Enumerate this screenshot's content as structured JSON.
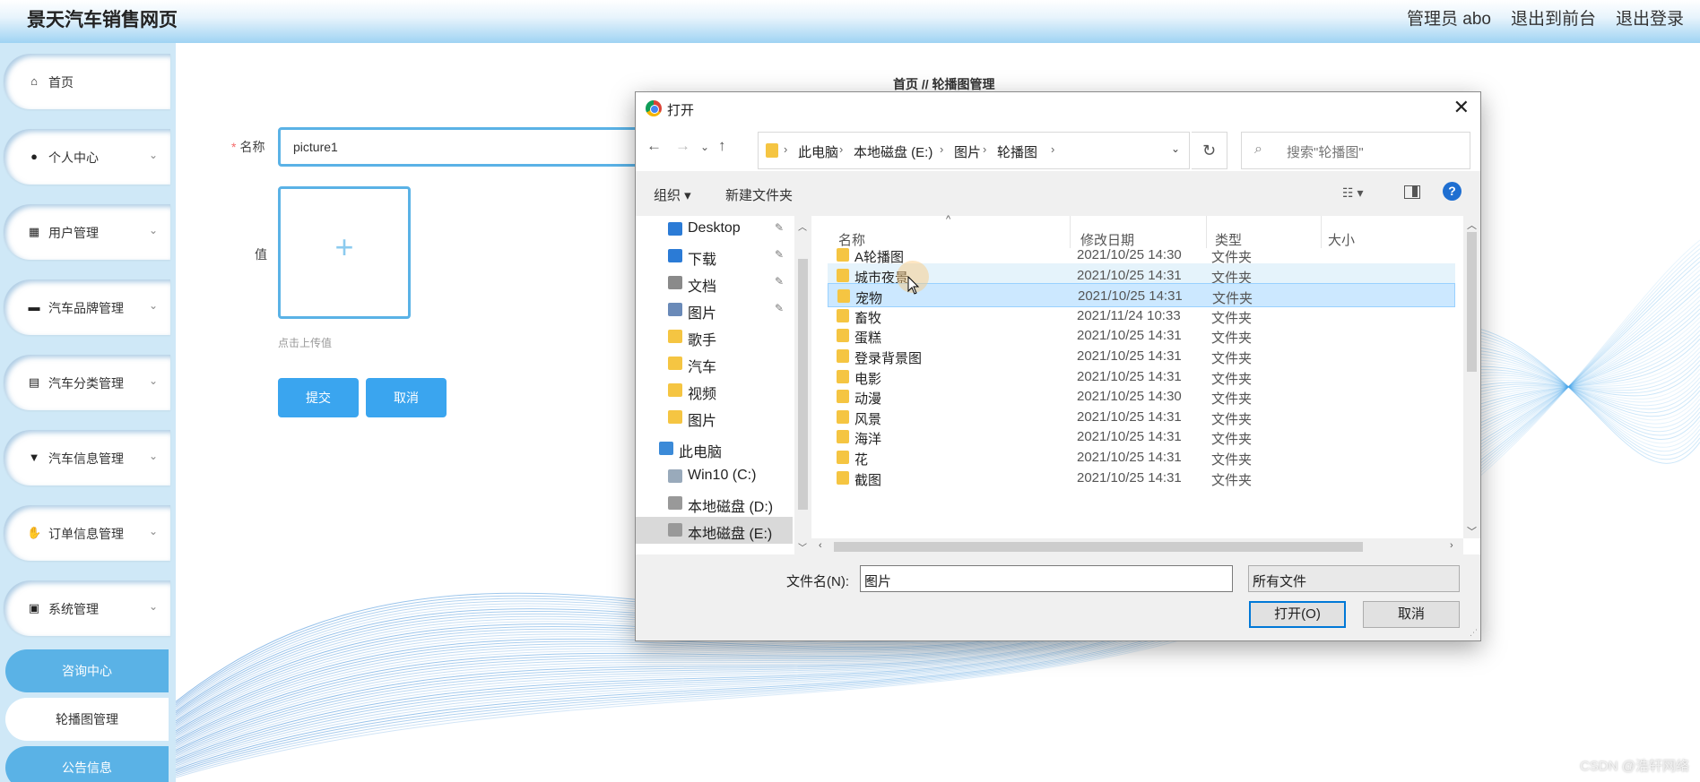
{
  "header": {
    "brand": "景天汽车销售网页",
    "nav": [
      "管理员 abo",
      "退出到前台",
      "退出登录"
    ]
  },
  "sidebar": {
    "items": [
      {
        "label": "首页",
        "icon": "home-icon",
        "glyph": "⌂",
        "has_arrow": false
      },
      {
        "label": "个人中心",
        "icon": "user-icon",
        "glyph": "●",
        "has_arrow": true
      },
      {
        "label": "用户管理",
        "icon": "grid-icon",
        "glyph": "▦",
        "has_arrow": true
      },
      {
        "label": "汽车品牌管理",
        "icon": "monitor-icon",
        "glyph": "▬",
        "has_arrow": true
      },
      {
        "label": "汽车分类管理",
        "icon": "clipboard-icon",
        "glyph": "▤",
        "has_arrow": true
      },
      {
        "label": "汽车信息管理",
        "icon": "brush-icon",
        "glyph": "▼",
        "has_arrow": true
      },
      {
        "label": "订单信息管理",
        "icon": "hand-icon",
        "glyph": "✋",
        "has_arrow": true
      },
      {
        "label": "系统管理",
        "icon": "briefcase-icon",
        "glyph": "▣",
        "has_arrow": true
      }
    ],
    "sub_items": [
      "咨询中心",
      "轮播图管理",
      "公告信息"
    ]
  },
  "main": {
    "breadcrumb": "首页 // 轮播图管理",
    "name_label": "名称",
    "name_required": "*",
    "name_value": "picture1",
    "value_label": "值",
    "upload_plus": "+",
    "upload_hint": "点击上传值",
    "submit": "提交",
    "cancel": "取消"
  },
  "dialog": {
    "title": "打开",
    "close": "✕",
    "path": [
      "此电脑",
      "本地磁盘 (E:)",
      "图片",
      "轮播图"
    ],
    "search_placeholder": "搜索\"轮播图\"",
    "toolbar": {
      "organize": "组织 ▾",
      "new_folder": "新建文件夹",
      "help": "?"
    },
    "nav_pane": [
      {
        "label": "Desktop",
        "pinned": true,
        "color": "#2b7bd6"
      },
      {
        "label": "下载",
        "pinned": true,
        "color": "#2b7bd6"
      },
      {
        "label": "文档",
        "pinned": true,
        "color": "#8a8a8a"
      },
      {
        "label": "图片",
        "pinned": true,
        "color": "#6a8ab8"
      },
      {
        "label": "歌手",
        "pinned": false,
        "color": "#f5c542"
      },
      {
        "label": "汽车",
        "pinned": false,
        "color": "#f5c542"
      },
      {
        "label": "视频",
        "pinned": false,
        "color": "#f5c542"
      },
      {
        "label": "图片",
        "pinned": false,
        "color": "#f5c542"
      },
      {
        "label": "此电脑",
        "pinned": false,
        "color": "#3b8ad8"
      },
      {
        "label": "Win10 (C:)",
        "pinned": false,
        "color": "#9ab"
      },
      {
        "label": "本地磁盘 (D:)",
        "pinned": false,
        "color": "#999"
      },
      {
        "label": "本地磁盘 (E:)",
        "pinned": false,
        "color": "#999"
      }
    ],
    "columns": [
      "名称",
      "修改日期",
      "类型",
      "大小"
    ],
    "files": [
      {
        "name": "A轮播图",
        "date": "2021/10/25 14:30",
        "type": "文件夹",
        "state": ""
      },
      {
        "name": "城市夜景",
        "date": "2021/10/25 14:31",
        "type": "文件夹",
        "state": "hov"
      },
      {
        "name": "宠物",
        "date": "2021/10/25 14:31",
        "type": "文件夹",
        "state": "sel"
      },
      {
        "name": "畜牧",
        "date": "2021/11/24 10:33",
        "type": "文件夹",
        "state": ""
      },
      {
        "name": "蛋糕",
        "date": "2021/10/25 14:31",
        "type": "文件夹",
        "state": ""
      },
      {
        "name": "登录背景图",
        "date": "2021/10/25 14:31",
        "type": "文件夹",
        "state": ""
      },
      {
        "name": "电影",
        "date": "2021/10/25 14:31",
        "type": "文件夹",
        "state": ""
      },
      {
        "name": "动漫",
        "date": "2021/10/25 14:30",
        "type": "文件夹",
        "state": ""
      },
      {
        "name": "风景",
        "date": "2021/10/25 14:31",
        "type": "文件夹",
        "state": ""
      },
      {
        "name": "海洋",
        "date": "2021/10/25 14:31",
        "type": "文件夹",
        "state": ""
      },
      {
        "name": "花",
        "date": "2021/10/25 14:31",
        "type": "文件夹",
        "state": ""
      },
      {
        "name": "截图",
        "date": "2021/10/25 14:31",
        "type": "文件夹",
        "state": ""
      }
    ],
    "filename_label": "文件名(N):",
    "filename_value": "图片",
    "filetype_value": "所有文件",
    "open_button": "打开(O)",
    "cancel_button": "取消"
  },
  "watermark": "CSDN @浩轩网络",
  "colors": {
    "accent": "#3aa5ef",
    "sidebar_bg": "#cfe8f7",
    "active_sub": "#5ab2e6"
  }
}
